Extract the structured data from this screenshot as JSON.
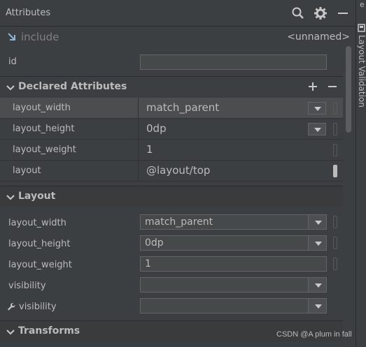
{
  "header": {
    "title": "Attributes"
  },
  "include": {
    "label": "include",
    "tag": "<unnamed>"
  },
  "id_row": {
    "label": "id",
    "value": ""
  },
  "declared": {
    "title": "Declared Attributes",
    "rows": [
      {
        "label": "layout_width",
        "value": "match_parent"
      },
      {
        "label": "layout_height",
        "value": "0dp"
      },
      {
        "label": "layout_weight",
        "value": "1"
      },
      {
        "label": "layout",
        "value": "@layout/top"
      }
    ]
  },
  "layout_section": {
    "title": "Layout",
    "rows": [
      {
        "label": "layout_width",
        "value": "match_parent"
      },
      {
        "label": "layout_height",
        "value": "0dp"
      },
      {
        "label": "layout_weight",
        "value": "1"
      },
      {
        "label": "visibility",
        "value": ""
      },
      {
        "label": "visibility",
        "value": ""
      }
    ]
  },
  "transforms": {
    "title": "Transforms"
  },
  "right_strip": {
    "text": "Layout Validation",
    "top_letter": "e"
  },
  "watermark": "CSDN @A plum in fall"
}
